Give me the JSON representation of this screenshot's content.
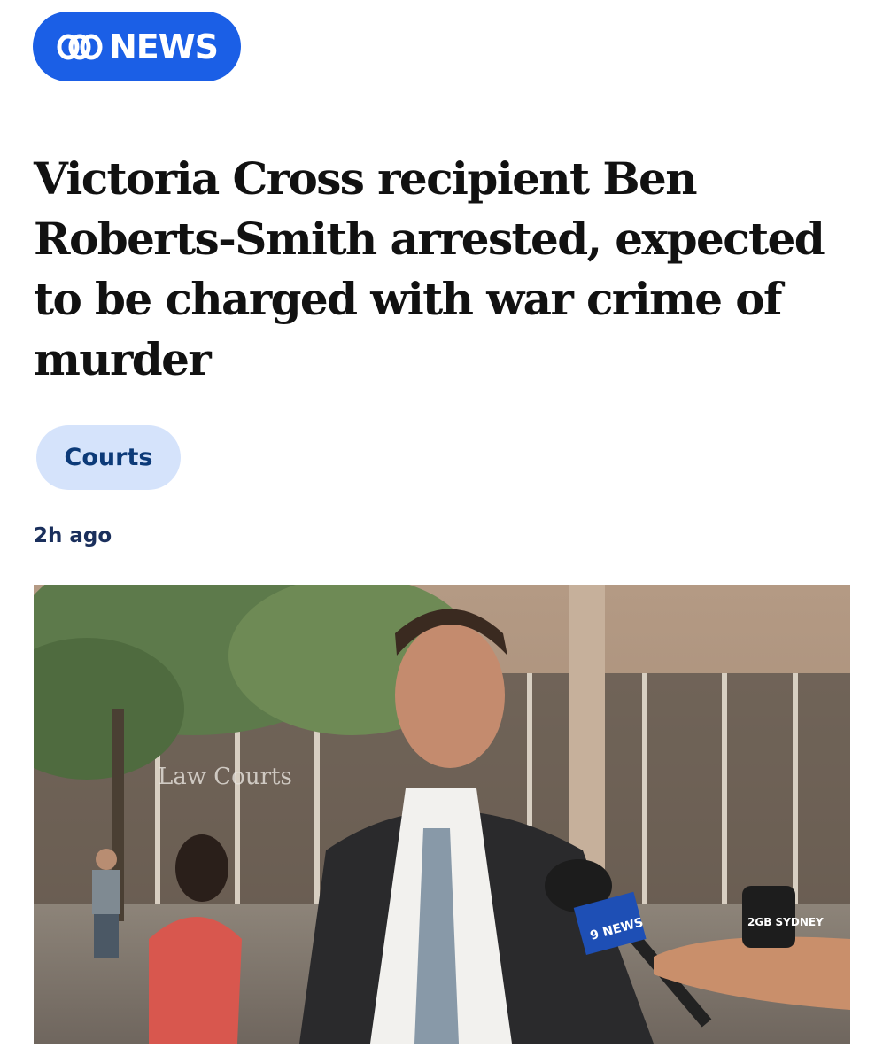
{
  "header": {
    "logo_text": "NEWS",
    "brand_color": "#1b5fe6",
    "logo_icon": "abc-logo-icon"
  },
  "article": {
    "headline": "Victoria Cross recipient Ben Roberts-Smith arrested, expected to be charged with war crime of murder",
    "tag": "Courts",
    "tag_color": "#d5e3fb",
    "timestamp": "2h ago",
    "image": {
      "building_sign": "Law Courts",
      "mic_label_1": "9 NEWS",
      "mic_label_2": "2GB SYDNEY"
    }
  }
}
